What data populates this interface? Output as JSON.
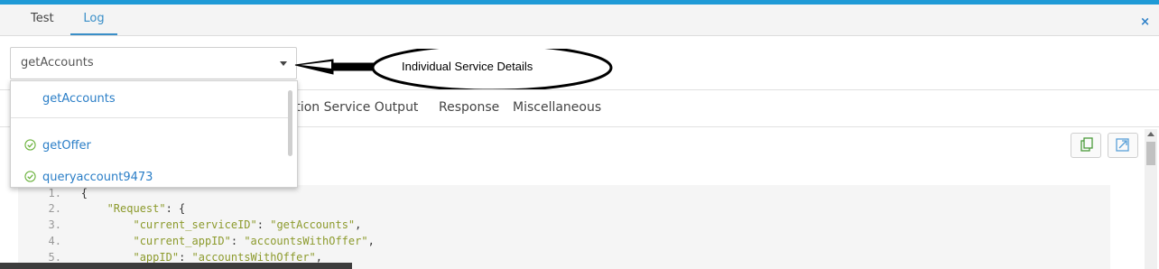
{
  "tabs": [
    {
      "label": "Test",
      "active": false
    },
    {
      "label": "Log",
      "active": true
    }
  ],
  "close_icon": "×",
  "service_select": {
    "selected": "getAccounts",
    "options": [
      {
        "label": "getAccounts",
        "status": "none"
      },
      {
        "label": "getOffer",
        "status": "success"
      },
      {
        "label": "queryaccount9473",
        "status": "success"
      }
    ]
  },
  "annotation": {
    "text": "Individual Service Details"
  },
  "subtabs": [
    "ration Service Output",
    "Response",
    "Miscellaneous"
  ],
  "toolbar": {
    "copy_icon": "copy-icon",
    "expand_icon": "expand-icon"
  },
  "code": {
    "lines": [
      {
        "n": "1.",
        "text": "{"
      },
      {
        "n": "2.",
        "key": "\"Request\"",
        "rest": ": {"
      },
      {
        "n": "3.",
        "key": "\"current_serviceID\"",
        "val": "\"getAccounts\"",
        "end": ","
      },
      {
        "n": "4.",
        "key": "\"current_appID\"",
        "val": "\"accountsWithOffer\"",
        "end": ","
      },
      {
        "n": "5.",
        "key": "\"appID\"",
        "val": "\"accountsWithOffer\"",
        "end": ","
      }
    ]
  },
  "colors": {
    "accent": "#1f9ad6",
    "link": "#2a7ec7",
    "success": "#6db33f",
    "code_string": "#8c9a2c"
  }
}
